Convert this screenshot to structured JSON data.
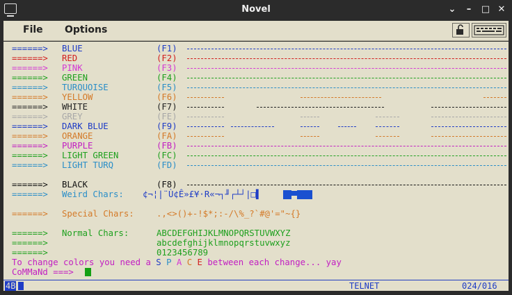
{
  "window": {
    "title": "Novel"
  },
  "menu": {
    "file": "File",
    "options": "Options"
  },
  "colors": {
    "blue": "#1e3cc6",
    "red": "#d21e1e",
    "pink": "#d438d4",
    "green": "#1ea01e",
    "turquoise": "#2a8ec8",
    "yellow": "#d47a28",
    "white": "#222222",
    "grey": "#a8a8a8",
    "darkblue": "#1e3cc6",
    "orange": "#d47a28",
    "purple": "#c21ec2",
    "black": "#111111",
    "lightgreen": "#1ea01e",
    "lightturq": "#2a8ec8"
  },
  "rows": [
    {
      "arrow": "======>",
      "name": "BLUE",
      "key": "(F1)",
      "color": "blue"
    },
    {
      "arrow": "======>",
      "name": "RED",
      "key": "(F2)",
      "color": "red"
    },
    {
      "arrow": "======>",
      "name": "PINK",
      "key": "(F3)",
      "color": "pink"
    },
    {
      "arrow": "======>",
      "name": "GREEN",
      "key": "(F4)",
      "color": "green"
    },
    {
      "arrow": "======>",
      "name": "TURQUOISE",
      "key": "(F5)",
      "color": "turquoise"
    },
    {
      "arrow": "======>",
      "name": "YELLOW",
      "key": "(F6)",
      "color": "yellow"
    },
    {
      "arrow": "======>",
      "name": "WHITE",
      "key": "(F7)",
      "color": "white"
    },
    {
      "arrow": "======>",
      "name": "GREY",
      "key": "(FE)",
      "color": "grey"
    },
    {
      "arrow": "======>",
      "name": "DARK BLUE",
      "key": "(F9)",
      "color": "darkblue"
    },
    {
      "arrow": "======>",
      "name": "ORANGE",
      "key": "(FA)",
      "color": "orange"
    },
    {
      "arrow": "======>",
      "name": "PURPLE",
      "key": "(FB)",
      "color": "purple"
    },
    {
      "arrow": "======>",
      "name": "LIGHT GREEN",
      "key": "(FC)",
      "color": "lightgreen"
    },
    {
      "arrow": "======>",
      "name": "LIGHT TURQ",
      "key": "(FD)",
      "color": "lightturq"
    }
  ],
  "black_row": {
    "arrow": "======>",
    "name": "BLACK",
    "key": "(F8)"
  },
  "weird": {
    "arrow": "======>",
    "label": "Weird Chars:",
    "chars": "¢¬¦|¨Ù¢Ê»£¥·R«¬┐╜┌┴┘|□▌"
  },
  "special": {
    "arrow": "======>",
    "label": "Special Chars:",
    "chars": ".,<>()+-!$*;:-/\\%_?`#@'=\"~{}"
  },
  "normal": {
    "arrow": "======>",
    "label": "Normal Chars:",
    "upper": "ABCDEFGHIJKLMNOPQRSTUVWXYZ",
    "lower": "abcdefghijklmnopqrstuvwxyz",
    "digits": "0123456789"
  },
  "message": {
    "before": "To change colors you need a ",
    "s": "S",
    "p": "P",
    "a": "A",
    "c": "C",
    "e": "E",
    "after": " between each change... yay"
  },
  "command": {
    "prompt": "CoMMaNd ===>"
  },
  "status": {
    "mode": "TELNET",
    "position": "024/016",
    "indicator": "4B"
  }
}
